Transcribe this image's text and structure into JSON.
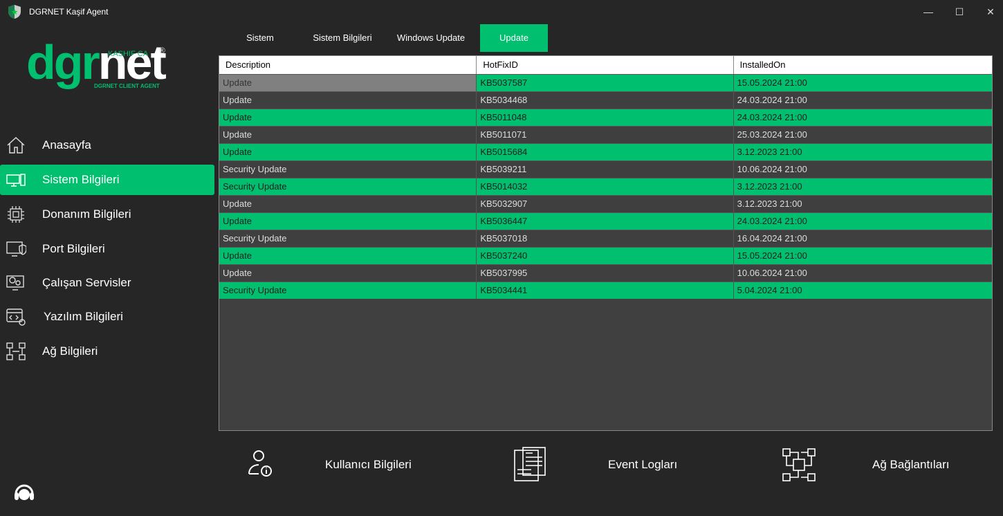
{
  "window": {
    "title": "DGRNET Kaşif Agent",
    "minimize": "—",
    "maximize": "☐",
    "close": "✕"
  },
  "logo": {
    "text_green": "dgr",
    "text_white": "net",
    "top": "KASHIF CA",
    "sub": "DGRNET CLIENT AGENT",
    "reg": "®"
  },
  "nav": [
    {
      "label": "Anasayfa",
      "icon": "home-icon"
    },
    {
      "label": "Sistem Bilgileri",
      "icon": "monitor-icon",
      "active": true
    },
    {
      "label": "Donanım Bilgileri",
      "icon": "chip-icon"
    },
    {
      "label": "Port Bilgileri",
      "icon": "shield-monitor-icon"
    },
    {
      "label": "Çalışan Servisler",
      "icon": "gear-monitor-icon"
    },
    {
      "label": "Yazılım Bilgileri",
      "icon": "code-window-icon"
    },
    {
      "label": "Ağ Bilgileri",
      "icon": "network-icon"
    }
  ],
  "tabs": [
    "Sistem",
    "Sistem Bilgileri",
    "Windows Update",
    "Update"
  ],
  "active_tab": "Update",
  "table": {
    "columns": [
      "Description",
      "HotFixID",
      "InstalledOn"
    ],
    "rows": [
      [
        "Update",
        "KB5037587",
        "15.05.2024 21:00"
      ],
      [
        "Update",
        "KB5034468",
        "24.03.2024 21:00"
      ],
      [
        "Update",
        "KB5011048",
        "24.03.2024 21:00"
      ],
      [
        "Update",
        "KB5011071",
        "25.03.2024 21:00"
      ],
      [
        "Update",
        "KB5015684",
        "3.12.2023 21:00"
      ],
      [
        "Security Update",
        "KB5039211",
        "10.06.2024 21:00"
      ],
      [
        "Security Update",
        "KB5014032",
        "3.12.2023 21:00"
      ],
      [
        "Update",
        "KB5032907",
        "3.12.2023 21:00"
      ],
      [
        "Update",
        "KB5036447",
        "24.03.2024 21:00"
      ],
      [
        "Security Update",
        "KB5037018",
        "16.04.2024 21:00"
      ],
      [
        "Update",
        "KB5037240",
        "15.05.2024 21:00"
      ],
      [
        "Update",
        "KB5037995",
        "10.06.2024 21:00"
      ],
      [
        "Security Update",
        "KB5034441",
        "5.04.2024 21:00"
      ]
    ]
  },
  "bottom": [
    {
      "label": "Kullanıcı Bilgileri",
      "icon": "user-info-icon"
    },
    {
      "label": "Event Logları",
      "icon": "log-document-icon"
    },
    {
      "label": "Ağ Bağlantıları",
      "icon": "network-connections-icon"
    }
  ],
  "colors": {
    "accent": "#00bf6f",
    "bg": "#262626"
  }
}
